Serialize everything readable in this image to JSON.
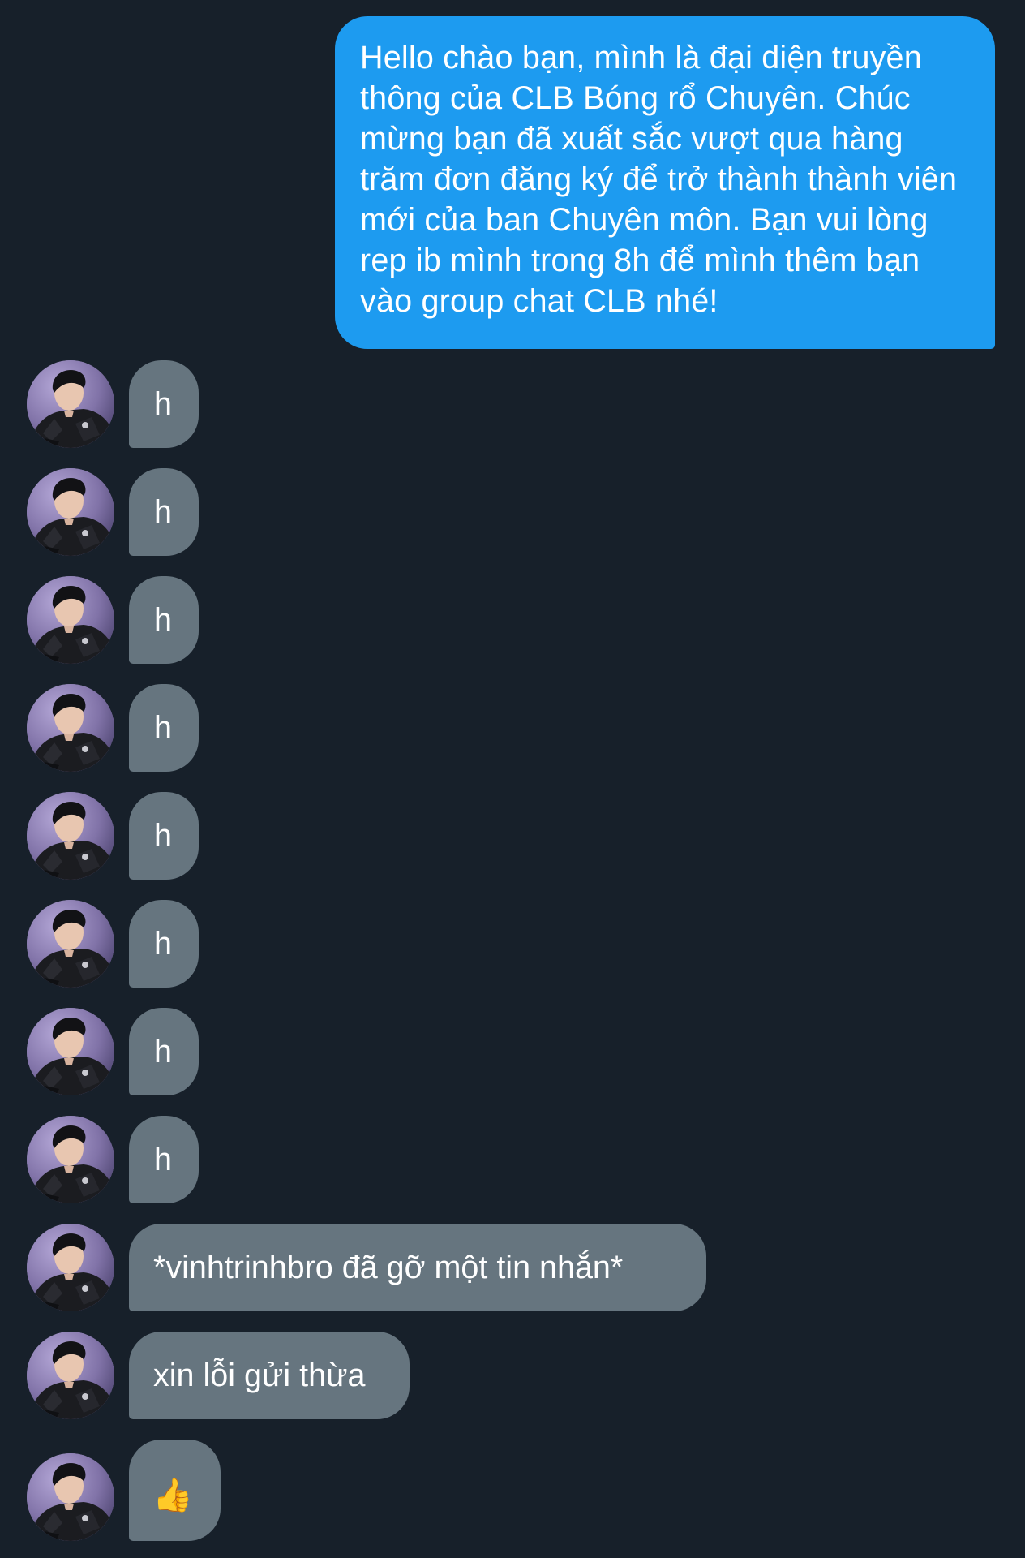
{
  "conversation": {
    "sent": [
      {
        "text": "Hello chào bạn, mình là đại diện truyền thông của CLB Bóng rổ Chuyên. Chúc mừng bạn đã xuất sắc vượt qua hàng trăm đơn đăng ký để trở thành thành viên mới của ban Chuyên môn. Bạn vui lòng rep ib mình trong 8h để mình thêm bạn vào group chat CLB nhé!"
      }
    ],
    "received": [
      {
        "text": "h"
      },
      {
        "text": "h"
      },
      {
        "text": "h"
      },
      {
        "text": "h"
      },
      {
        "text": "h"
      },
      {
        "text": "h"
      },
      {
        "text": "h"
      },
      {
        "text": "h"
      },
      {
        "text": "*vinhtrinhbro đã gỡ một tin nhắn*"
      },
      {
        "text": "xin lỗi gửi thừa"
      },
      {
        "text": "👍"
      }
    ]
  },
  "colors": {
    "background": "#17202a",
    "sent_bubble": "#1d9bf0",
    "received_bubble": "#66757f",
    "text": "#ffffff"
  }
}
